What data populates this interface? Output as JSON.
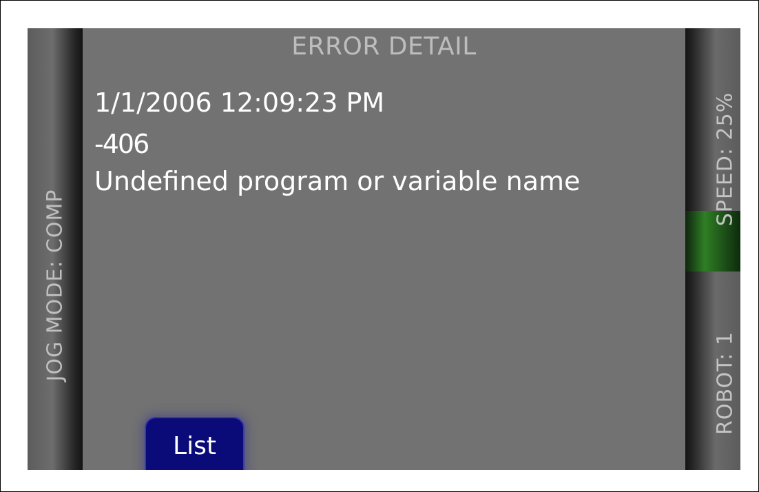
{
  "left_bar": {
    "label": "JOG MODE: COMP"
  },
  "right_bar": {
    "speed_label": "SPEED: 25%",
    "robot_label": "ROBOT: 1"
  },
  "panel": {
    "title": "ERROR DETAIL",
    "timestamp": "1/1/2006 12:09:23 PM",
    "error_code": "-406",
    "error_message": "Undefined program or variable name"
  },
  "buttons": {
    "list_label": "List"
  },
  "colors": {
    "screen_bg": "#727272",
    "speed_highlight": "#2f7f25",
    "button_bg": "#0a0a78",
    "text": "#ffffff"
  }
}
